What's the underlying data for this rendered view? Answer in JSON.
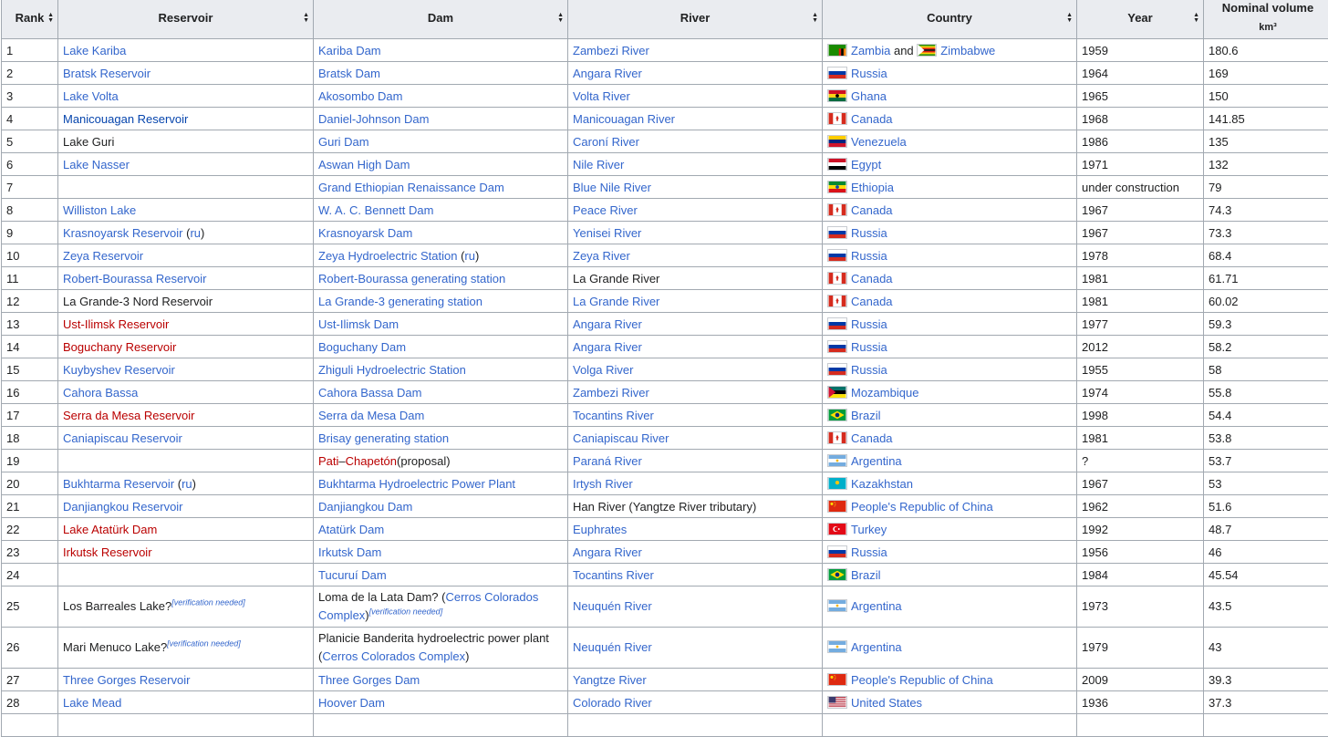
{
  "headers": {
    "rank": "Rank",
    "reservoir": "Reservoir",
    "dam": "Dam",
    "river": "River",
    "country": "Country",
    "year": "Year",
    "volume_line1": "Nominal volume",
    "volume_line2": "km³"
  },
  "flags": {
    "zambia": {
      "type": "zambia"
    },
    "zimbabwe": {
      "type": "zimbabwe"
    },
    "russia": {
      "type": "h3",
      "colors": [
        "#ffffff",
        "#0039a6",
        "#d52b1e"
      ]
    },
    "ghana": {
      "type": "h3star",
      "colors": [
        "#ce1126",
        "#fcd116",
        "#006b3f"
      ]
    },
    "canada": {
      "type": "canada"
    },
    "venezuela": {
      "type": "h3",
      "colors": [
        "#ffcc00",
        "#00247d",
        "#cf142b"
      ]
    },
    "egypt": {
      "type": "h3",
      "colors": [
        "#ce1126",
        "#ffffff",
        "#000000"
      ]
    },
    "ethiopia": {
      "type": "h3star",
      "colors": [
        "#078930",
        "#fcdd09",
        "#da121a"
      ]
    },
    "mozambique": {
      "type": "mozambique"
    },
    "brazil": {
      "type": "brazil"
    },
    "argentina": {
      "type": "h3",
      "colors": [
        "#74acdf",
        "#ffffff",
        "#74acdf"
      ]
    },
    "kazakhstan": {
      "type": "kazakhstan"
    },
    "china": {
      "type": "china"
    },
    "turkey": {
      "type": "turkey"
    },
    "usa": {
      "type": "usa"
    }
  },
  "rows": [
    {
      "rank": "1",
      "reservoir": [
        {
          "t": "Lake Kariba",
          "c": "lnk"
        }
      ],
      "dam": [
        {
          "t": "Kariba Dam",
          "c": "lnk"
        }
      ],
      "river": [
        {
          "t": "Zambezi River",
          "c": "lnk"
        }
      ],
      "country": [
        {
          "f": "zambia"
        },
        {
          "t": "Zambia",
          "c": "lnk"
        },
        {
          "t": " and ",
          "c": "plain"
        },
        {
          "f": "zimbabwe"
        },
        {
          "t": "Zimbabwe",
          "c": "lnk"
        }
      ],
      "year": "1959",
      "volume": "180.6"
    },
    {
      "rank": "2",
      "reservoir": [
        {
          "t": "Bratsk Reservoir",
          "c": "lnk"
        }
      ],
      "dam": [
        {
          "t": "Bratsk Dam",
          "c": "lnk"
        }
      ],
      "river": [
        {
          "t": "Angara River",
          "c": "lnk"
        }
      ],
      "country": [
        {
          "f": "russia"
        },
        {
          "t": "Russia",
          "c": "lnk"
        }
      ],
      "year": "1964",
      "volume": "169"
    },
    {
      "rank": "3",
      "reservoir": [
        {
          "t": "Lake Volta",
          "c": "lnk"
        }
      ],
      "dam": [
        {
          "t": "Akosombo Dam",
          "c": "lnk"
        }
      ],
      "river": [
        {
          "t": "Volta River",
          "c": "lnk"
        }
      ],
      "country": [
        {
          "f": "ghana"
        },
        {
          "t": "Ghana",
          "c": "lnk"
        }
      ],
      "year": "1965",
      "volume": "150"
    },
    {
      "rank": "4",
      "reservoir": [
        {
          "t": "Manicouagan Reservoir",
          "c": "dlnk"
        }
      ],
      "dam": [
        {
          "t": "Daniel-Johnson Dam",
          "c": "lnk"
        }
      ],
      "river": [
        {
          "t": "Manicouagan River",
          "c": "lnk"
        }
      ],
      "country": [
        {
          "f": "canada"
        },
        {
          "t": "Canada",
          "c": "lnk"
        }
      ],
      "year": "1968",
      "volume": "141.85"
    },
    {
      "rank": "5",
      "reservoir": [
        {
          "t": "Lake Guri",
          "c": "plain"
        }
      ],
      "dam": [
        {
          "t": "Guri Dam",
          "c": "lnk"
        }
      ],
      "river": [
        {
          "t": "Caroní River",
          "c": "lnk"
        }
      ],
      "country": [
        {
          "f": "venezuela"
        },
        {
          "t": "Venezuela",
          "c": "lnk"
        }
      ],
      "year": "1986",
      "volume": "135"
    },
    {
      "rank": "6",
      "reservoir": [
        {
          "t": "Lake Nasser",
          "c": "lnk"
        }
      ],
      "dam": [
        {
          "t": "Aswan High Dam",
          "c": "lnk"
        }
      ],
      "river": [
        {
          "t": "Nile River",
          "c": "lnk"
        }
      ],
      "country": [
        {
          "f": "egypt"
        },
        {
          "t": "Egypt",
          "c": "lnk"
        }
      ],
      "year": "1971",
      "volume": "132"
    },
    {
      "rank": "7",
      "reservoir": [],
      "dam": [
        {
          "t": "Grand Ethiopian Renaissance Dam",
          "c": "lnk"
        }
      ],
      "river": [
        {
          "t": "Blue Nile River",
          "c": "lnk"
        }
      ],
      "country": [
        {
          "f": "ethiopia"
        },
        {
          "t": "Ethiopia",
          "c": "lnk"
        }
      ],
      "year": "under construction",
      "volume": "79"
    },
    {
      "rank": "8",
      "reservoir": [
        {
          "t": "Williston Lake",
          "c": "lnk"
        }
      ],
      "dam": [
        {
          "t": "W. A. C. Bennett Dam",
          "c": "lnk"
        }
      ],
      "river": [
        {
          "t": "Peace River",
          "c": "lnk"
        }
      ],
      "country": [
        {
          "f": "canada"
        },
        {
          "t": "Canada",
          "c": "lnk"
        }
      ],
      "year": "1967",
      "volume": "74.3"
    },
    {
      "rank": "9",
      "reservoir": [
        {
          "t": "Krasnoyarsk Reservoir",
          "c": "lnk"
        },
        {
          "t": " (",
          "c": "plain"
        },
        {
          "t": "ru",
          "c": "lnk"
        },
        {
          "t": ")",
          "c": "plain"
        }
      ],
      "dam": [
        {
          "t": "Krasnoyarsk Dam",
          "c": "lnk"
        }
      ],
      "river": [
        {
          "t": "Yenisei River",
          "c": "lnk"
        }
      ],
      "country": [
        {
          "f": "russia"
        },
        {
          "t": "Russia",
          "c": "lnk"
        }
      ],
      "year": "1967",
      "volume": "73.3"
    },
    {
      "rank": "10",
      "reservoir": [
        {
          "t": "Zeya Reservoir",
          "c": "lnk"
        }
      ],
      "dam": [
        {
          "t": "Zeya Hydroelectric Station",
          "c": "lnk"
        },
        {
          "t": " (",
          "c": "plain"
        },
        {
          "t": "ru",
          "c": "lnk"
        },
        {
          "t": ")",
          "c": "plain"
        }
      ],
      "river": [
        {
          "t": "Zeya River",
          "c": "lnk"
        }
      ],
      "country": [
        {
          "f": "russia"
        },
        {
          "t": "Russia",
          "c": "lnk"
        }
      ],
      "year": "1978",
      "volume": "68.4"
    },
    {
      "rank": "11",
      "reservoir": [
        {
          "t": "Robert-Bourassa Reservoir",
          "c": "lnk"
        }
      ],
      "dam": [
        {
          "t": "Robert-Bourassa generating station",
          "c": "lnk"
        }
      ],
      "river": [
        {
          "t": "La Grande River",
          "c": "plain"
        }
      ],
      "country": [
        {
          "f": "canada"
        },
        {
          "t": "Canada",
          "c": "lnk"
        }
      ],
      "year": "1981",
      "volume": "61.71"
    },
    {
      "rank": "12",
      "reservoir": [
        {
          "t": "La Grande-3 Nord Reservoir",
          "c": "plain"
        }
      ],
      "dam": [
        {
          "t": "La Grande-3 generating station",
          "c": "lnk"
        }
      ],
      "river": [
        {
          "t": "La Grande River",
          "c": "lnk"
        }
      ],
      "country": [
        {
          "f": "canada"
        },
        {
          "t": "Canada",
          "c": "lnk"
        }
      ],
      "year": "1981",
      "volume": "60.02"
    },
    {
      "rank": "13",
      "reservoir": [
        {
          "t": "Ust-Ilimsk Reservoir",
          "c": "red"
        }
      ],
      "dam": [
        {
          "t": "Ust-Ilimsk Dam",
          "c": "lnk"
        }
      ],
      "river": [
        {
          "t": "Angara River",
          "c": "lnk"
        }
      ],
      "country": [
        {
          "f": "russia"
        },
        {
          "t": "Russia",
          "c": "lnk"
        }
      ],
      "year": "1977",
      "volume": "59.3"
    },
    {
      "rank": "14",
      "reservoir": [
        {
          "t": "Boguchany Reservoir",
          "c": "red"
        }
      ],
      "dam": [
        {
          "t": "Boguchany Dam",
          "c": "lnk"
        }
      ],
      "river": [
        {
          "t": "Angara River",
          "c": "lnk"
        }
      ],
      "country": [
        {
          "f": "russia"
        },
        {
          "t": "Russia",
          "c": "lnk"
        }
      ],
      "year": "2012",
      "volume": "58.2"
    },
    {
      "rank": "15",
      "reservoir": [
        {
          "t": "Kuybyshev Reservoir",
          "c": "lnk"
        }
      ],
      "dam": [
        {
          "t": "Zhiguli Hydroelectric Station",
          "c": "lnk"
        }
      ],
      "river": [
        {
          "t": "Volga River",
          "c": "lnk"
        }
      ],
      "country": [
        {
          "f": "russia"
        },
        {
          "t": "Russia",
          "c": "lnk"
        }
      ],
      "year": "1955",
      "volume": "58"
    },
    {
      "rank": "16",
      "reservoir": [
        {
          "t": "Cahora Bassa",
          "c": "lnk"
        }
      ],
      "dam": [
        {
          "t": "Cahora Bassa Dam",
          "c": "lnk"
        }
      ],
      "river": [
        {
          "t": "Zambezi River",
          "c": "lnk"
        }
      ],
      "country": [
        {
          "f": "mozambique"
        },
        {
          "t": "Mozambique",
          "c": "lnk"
        }
      ],
      "year": "1974",
      "volume": "55.8"
    },
    {
      "rank": "17",
      "reservoir": [
        {
          "t": "Serra da Mesa Reservoir",
          "c": "red"
        }
      ],
      "dam": [
        {
          "t": "Serra da Mesa Dam",
          "c": "lnk"
        }
      ],
      "river": [
        {
          "t": "Tocantins River",
          "c": "lnk"
        }
      ],
      "country": [
        {
          "f": "brazil"
        },
        {
          "t": "Brazil",
          "c": "lnk"
        }
      ],
      "year": "1998",
      "volume": "54.4"
    },
    {
      "rank": "18",
      "reservoir": [
        {
          "t": "Caniapiscau Reservoir",
          "c": "lnk"
        }
      ],
      "dam": [
        {
          "t": "Brisay generating station",
          "c": "lnk"
        }
      ],
      "river": [
        {
          "t": "Caniapiscau River",
          "c": "lnk"
        }
      ],
      "country": [
        {
          "f": "canada"
        },
        {
          "t": "Canada",
          "c": "lnk"
        }
      ],
      "year": "1981",
      "volume": "53.8"
    },
    {
      "rank": "19",
      "reservoir": [],
      "dam": [
        {
          "t": "Pati",
          "c": "red"
        },
        {
          "t": "–",
          "c": "plain"
        },
        {
          "t": "Chapetón",
          "c": "red"
        },
        {
          "t": "(proposal)",
          "c": "plain"
        }
      ],
      "river": [
        {
          "t": "Paraná River",
          "c": "lnk"
        }
      ],
      "country": [
        {
          "f": "argentina"
        },
        {
          "t": "Argentina",
          "c": "lnk"
        }
      ],
      "year": "?",
      "volume": "53.7"
    },
    {
      "rank": "20",
      "reservoir": [
        {
          "t": "Bukhtarma Reservoir",
          "c": "lnk"
        },
        {
          "t": " (",
          "c": "plain"
        },
        {
          "t": "ru",
          "c": "lnk"
        },
        {
          "t": ")",
          "c": "plain"
        }
      ],
      "dam": [
        {
          "t": "Bukhtarma Hydroelectric Power Plant",
          "c": "lnk"
        }
      ],
      "river": [
        {
          "t": "Irtysh River",
          "c": "lnk"
        }
      ],
      "country": [
        {
          "f": "kazakhstan"
        },
        {
          "t": "Kazakhstan",
          "c": "lnk"
        }
      ],
      "year": "1967",
      "volume": "53"
    },
    {
      "rank": "21",
      "reservoir": [
        {
          "t": "Danjiangkou Reservoir",
          "c": "lnk"
        }
      ],
      "dam": [
        {
          "t": "Danjiangkou Dam",
          "c": "lnk"
        }
      ],
      "river": [
        {
          "t": "Han River (Yangtze River tributary)",
          "c": "plain"
        }
      ],
      "country": [
        {
          "f": "china"
        },
        {
          "t": "People's Republic of China",
          "c": "lnk"
        }
      ],
      "year": "1962",
      "volume": "51.6"
    },
    {
      "rank": "22",
      "reservoir": [
        {
          "t": "Lake Atatürk Dam",
          "c": "red"
        }
      ],
      "dam": [
        {
          "t": "Atatürk Dam",
          "c": "lnk"
        }
      ],
      "river": [
        {
          "t": "Euphrates",
          "c": "lnk"
        }
      ],
      "country": [
        {
          "f": "turkey"
        },
        {
          "t": "Turkey",
          "c": "lnk"
        }
      ],
      "year": "1992",
      "volume": "48.7"
    },
    {
      "rank": "23",
      "reservoir": [
        {
          "t": "Irkutsk Reservoir",
          "c": "red"
        }
      ],
      "dam": [
        {
          "t": "Irkutsk Dam",
          "c": "lnk"
        }
      ],
      "river": [
        {
          "t": "Angara River",
          "c": "lnk"
        }
      ],
      "country": [
        {
          "f": "russia"
        },
        {
          "t": "Russia",
          "c": "lnk"
        }
      ],
      "year": "1956",
      "volume": "46"
    },
    {
      "rank": "24",
      "reservoir": [],
      "dam": [
        {
          "t": "Tucuruí Dam",
          "c": "lnk"
        }
      ],
      "river": [
        {
          "t": "Tocantins River",
          "c": "lnk"
        }
      ],
      "country": [
        {
          "f": "brazil"
        },
        {
          "t": "Brazil",
          "c": "lnk"
        }
      ],
      "year": "1984",
      "volume": "45.54"
    },
    {
      "rank": "25",
      "tall": true,
      "reservoir": [
        {
          "t": "Los Barreales Lake?",
          "c": "plain"
        },
        {
          "s": "[verification needed]"
        }
      ],
      "dam": [
        {
          "t": "Loma de la Lata Dam? (",
          "c": "plain"
        },
        {
          "t": "Cerros Colorados Complex",
          "c": "lnk"
        },
        {
          "t": ")",
          "c": "plain"
        },
        {
          "s": "[verification needed]"
        }
      ],
      "river": [
        {
          "t": "Neuquén River",
          "c": "lnk"
        }
      ],
      "country": [
        {
          "f": "argentina"
        },
        {
          "t": "Argentina",
          "c": "lnk"
        }
      ],
      "year": "1973",
      "volume": "43.5"
    },
    {
      "rank": "26",
      "tall": true,
      "reservoir": [
        {
          "t": "Mari Menuco Lake?",
          "c": "plain"
        },
        {
          "s": "[verification needed]"
        }
      ],
      "dam": [
        {
          "t": "Planicie Banderita hydroelectric power plant (",
          "c": "plain"
        },
        {
          "t": "Cerros Colorados Complex",
          "c": "lnk"
        },
        {
          "t": ")",
          "c": "plain"
        }
      ],
      "river": [
        {
          "t": "Neuquén River",
          "c": "lnk"
        }
      ],
      "country": [
        {
          "f": "argentina"
        },
        {
          "t": "Argentina",
          "c": "lnk"
        }
      ],
      "year": "1979",
      "volume": "43"
    },
    {
      "rank": "27",
      "reservoir": [
        {
          "t": "Three Gorges Reservoir",
          "c": "lnk"
        }
      ],
      "dam": [
        {
          "t": "Three Gorges Dam",
          "c": "lnk"
        }
      ],
      "river": [
        {
          "t": "Yangtze River",
          "c": "lnk"
        }
      ],
      "country": [
        {
          "f": "china"
        },
        {
          "t": "People's Republic of China",
          "c": "lnk"
        }
      ],
      "year": "2009",
      "volume": "39.3"
    },
    {
      "rank": "28",
      "reservoir": [
        {
          "t": "Lake Mead",
          "c": "lnk"
        }
      ],
      "dam": [
        {
          "t": "Hoover Dam",
          "c": "lnk"
        }
      ],
      "river": [
        {
          "t": "Colorado River",
          "c": "lnk"
        }
      ],
      "country": [
        {
          "f": "usa"
        },
        {
          "t": "United States",
          "c": "lnk"
        }
      ],
      "year": "1936",
      "volume": "37.3"
    },
    {
      "rank": "",
      "reservoir": [],
      "dam": [],
      "river": [],
      "country": [],
      "year": "",
      "volume": ""
    }
  ]
}
